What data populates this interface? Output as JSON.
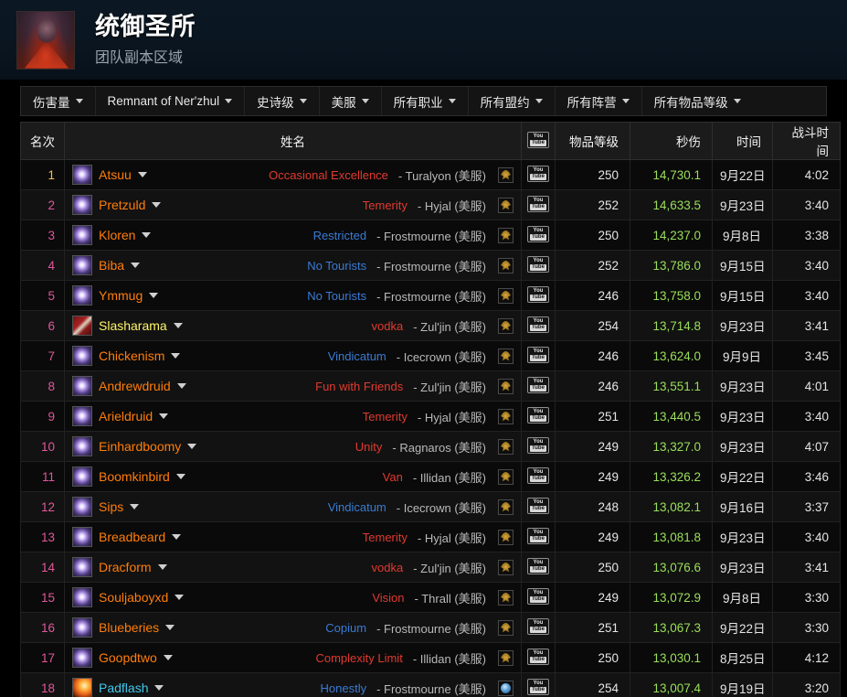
{
  "header": {
    "title": "统御圣所",
    "subtitle": "团队副本区域",
    "boss_icon": "raid-boss-portrait"
  },
  "filters": [
    {
      "label": "伤害量",
      "name": "metric"
    },
    {
      "label": "Remnant of Ner'zhul",
      "name": "boss"
    },
    {
      "label": "史诗级",
      "name": "difficulty"
    },
    {
      "label": "美服",
      "name": "region"
    },
    {
      "label": "所有职业",
      "name": "class"
    },
    {
      "label": "所有盟约",
      "name": "covenant"
    },
    {
      "label": "所有阵营",
      "name": "faction"
    },
    {
      "label": "所有物品等级",
      "name": "item-level"
    }
  ],
  "columns": {
    "rank": "名次",
    "name": "姓名",
    "video": "youtube-icon",
    "ilvl": "物品等级",
    "dps": "秒伤",
    "date": "时间",
    "length": "战斗时间"
  },
  "colors": {
    "druid": "#ff7d0a",
    "rogue": "#fff569",
    "mage": "#40c7eb",
    "rank_first": "#f2c14e",
    "rank_other": "#e0579b",
    "dps": "#9ade5a"
  },
  "rows": [
    {
      "rank": "1",
      "spec": "starfire",
      "name": "Atsuu",
      "name_color": "#ff7d0a",
      "guild": "Occasional Excellence",
      "guild_color": "#e03a2f",
      "realm": "- Turalyon (美服)",
      "faction": "horde",
      "ilvl": "250",
      "dps": "14,730.1",
      "date": "9月22日",
      "length": "4:02"
    },
    {
      "rank": "2",
      "spec": "starfire",
      "name": "Pretzuld",
      "name_color": "#ff7d0a",
      "guild": "Temerity",
      "guild_color": "#e03a2f",
      "realm": "- Hyjal (美服)",
      "faction": "horde",
      "ilvl": "252",
      "dps": "14,633.5",
      "date": "9月23日",
      "length": "3:40"
    },
    {
      "rank": "3",
      "spec": "starfire",
      "name": "Kloren",
      "name_color": "#ff7d0a",
      "guild": "Restricted",
      "guild_color": "#3a7bd5",
      "realm": "- Frostmourne (美服)",
      "faction": "horde",
      "ilvl": "250",
      "dps": "14,237.0",
      "date": "9月8日",
      "length": "3:38"
    },
    {
      "rank": "4",
      "spec": "starfire",
      "name": "Biba",
      "name_color": "#ff7d0a",
      "guild": "No Tourists",
      "guild_color": "#3a7bd5",
      "realm": "- Frostmourne (美服)",
      "faction": "horde",
      "ilvl": "252",
      "dps": "13,786.0",
      "date": "9月15日",
      "length": "3:40"
    },
    {
      "rank": "5",
      "spec": "starfire",
      "name": "Ymmug",
      "name_color": "#ff7d0a",
      "guild": "No Tourists",
      "guild_color": "#3a7bd5",
      "realm": "- Frostmourne (美服)",
      "faction": "horde",
      "ilvl": "246",
      "dps": "13,758.0",
      "date": "9月15日",
      "length": "3:40"
    },
    {
      "rank": "6",
      "spec": "rogue",
      "name": "Slasharama",
      "name_color": "#fff569",
      "guild": "vodka",
      "guild_color": "#e03a2f",
      "realm": "- Zul'jin (美服)",
      "faction": "horde",
      "ilvl": "254",
      "dps": "13,714.8",
      "date": "9月23日",
      "length": "3:41"
    },
    {
      "rank": "7",
      "spec": "starfire",
      "name": "Chickenism",
      "name_color": "#ff7d0a",
      "guild": "Vindicatum",
      "guild_color": "#3a7bd5",
      "realm": "- Icecrown (美服)",
      "faction": "horde",
      "ilvl": "246",
      "dps": "13,624.0",
      "date": "9月9日",
      "length": "3:45"
    },
    {
      "rank": "8",
      "spec": "starfire",
      "name": "Andrewdruid",
      "name_color": "#ff7d0a",
      "guild": "Fun with Friends",
      "guild_color": "#e03a2f",
      "realm": "- Zul'jin (美服)",
      "faction": "horde",
      "ilvl": "246",
      "dps": "13,551.1",
      "date": "9月23日",
      "length": "4:01"
    },
    {
      "rank": "9",
      "spec": "starfire",
      "name": "Arieldruid",
      "name_color": "#ff7d0a",
      "guild": "Temerity",
      "guild_color": "#e03a2f",
      "realm": "- Hyjal (美服)",
      "faction": "horde",
      "ilvl": "251",
      "dps": "13,440.5",
      "date": "9月23日",
      "length": "3:40"
    },
    {
      "rank": "10",
      "spec": "starfire",
      "name": "Einhardboomy",
      "name_color": "#ff7d0a",
      "guild": "Unity",
      "guild_color": "#e03a2f",
      "realm": "- Ragnaros (美服)",
      "faction": "horde",
      "ilvl": "249",
      "dps": "13,327.0",
      "date": "9月23日",
      "length": "4:07"
    },
    {
      "rank": "11",
      "spec": "starfire",
      "name": "Boomkinbird",
      "name_color": "#ff7d0a",
      "guild": "Van",
      "guild_color": "#e03a2f",
      "realm": "- Illidan (美服)",
      "faction": "horde",
      "ilvl": "249",
      "dps": "13,326.2",
      "date": "9月22日",
      "length": "3:46"
    },
    {
      "rank": "12",
      "spec": "starfire",
      "name": "Sips",
      "name_color": "#ff7d0a",
      "guild": "Vindicatum",
      "guild_color": "#3a7bd5",
      "realm": "- Icecrown (美服)",
      "faction": "horde",
      "ilvl": "248",
      "dps": "13,082.1",
      "date": "9月16日",
      "length": "3:37"
    },
    {
      "rank": "13",
      "spec": "starfire",
      "name": "Breadbeard",
      "name_color": "#ff7d0a",
      "guild": "Temerity",
      "guild_color": "#e03a2f",
      "realm": "- Hyjal (美服)",
      "faction": "horde",
      "ilvl": "249",
      "dps": "13,081.8",
      "date": "9月23日",
      "length": "3:40"
    },
    {
      "rank": "14",
      "spec": "starfire",
      "name": "Dracform",
      "name_color": "#ff7d0a",
      "guild": "vodka",
      "guild_color": "#e03a2f",
      "realm": "- Zul'jin (美服)",
      "faction": "horde",
      "ilvl": "250",
      "dps": "13,076.6",
      "date": "9月23日",
      "length": "3:41"
    },
    {
      "rank": "15",
      "spec": "starfire",
      "name": "Souljaboyxd",
      "name_color": "#ff7d0a",
      "guild": "Vision",
      "guild_color": "#e03a2f",
      "realm": "- Thrall (美服)",
      "faction": "horde",
      "ilvl": "249",
      "dps": "13,072.9",
      "date": "9月8日",
      "length": "3:30"
    },
    {
      "rank": "16",
      "spec": "starfire",
      "name": "Blueberies",
      "name_color": "#ff7d0a",
      "guild": "Copium",
      "guild_color": "#3a7bd5",
      "realm": "- Frostmourne (美服)",
      "faction": "horde",
      "ilvl": "251",
      "dps": "13,067.3",
      "date": "9月22日",
      "length": "3:30"
    },
    {
      "rank": "17",
      "spec": "starfire",
      "name": "Goopdtwo",
      "name_color": "#ff7d0a",
      "guild": "Complexity Limit",
      "guild_color": "#e03a2f",
      "realm": "- Illidan (美服)",
      "faction": "horde",
      "ilvl": "250",
      "dps": "13,030.1",
      "date": "8月25日",
      "length": "4:12"
    },
    {
      "rank": "18",
      "spec": "fire",
      "name": "Padflash",
      "name_color": "#40c7eb",
      "guild": "Honestly",
      "guild_color": "#3a7bd5",
      "realm": "- Frostmourne (美服)",
      "faction": "alliance",
      "ilvl": "254",
      "dps": "13,007.4",
      "date": "9月19日",
      "length": "3:20"
    }
  ]
}
